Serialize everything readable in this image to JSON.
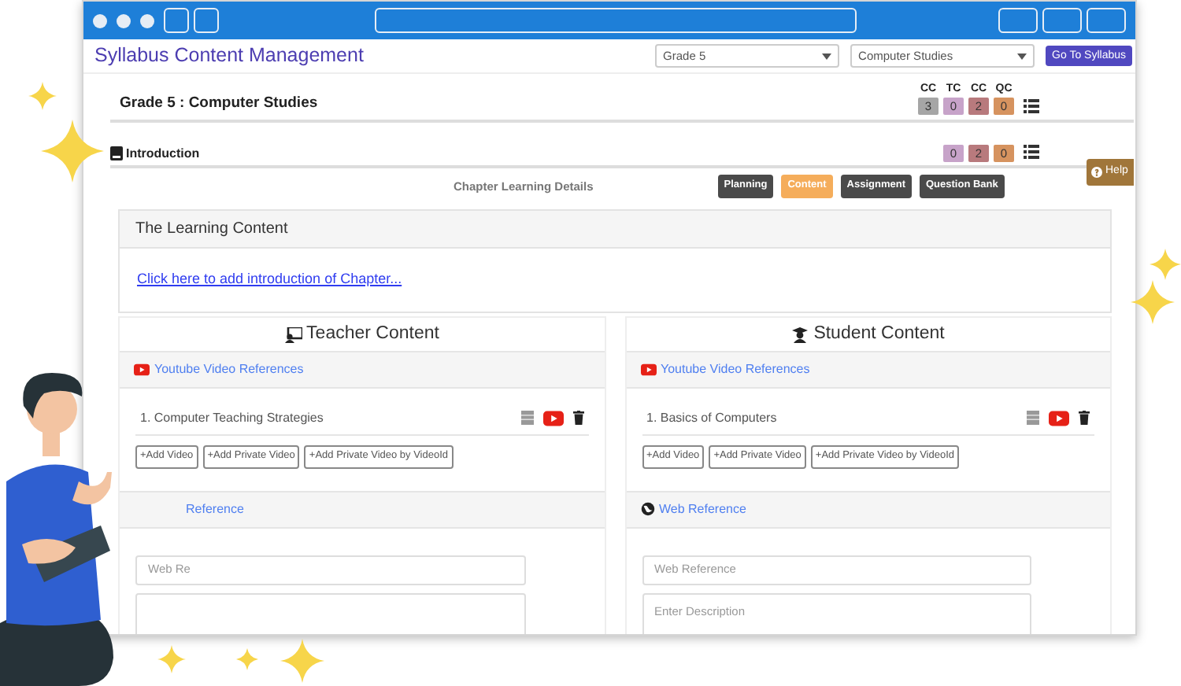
{
  "header": {
    "title": "Syllabus Content Management",
    "selects": [
      {
        "value": "Grade 5"
      },
      {
        "value": "Computer Studies"
      }
    ],
    "button": "Go To Syllabus"
  },
  "course": {
    "title": "Grade 5 : Computer Studies",
    "counts": [
      {
        "label": "CC",
        "value": "3",
        "color": "#a6a6a6"
      },
      {
        "label": "TC",
        "value": "0",
        "color": "#c7a3c9"
      },
      {
        "label": "CC",
        "value": "2",
        "color": "#b87a7d"
      },
      {
        "label": "QC",
        "value": "0",
        "color": "#d6935f"
      }
    ]
  },
  "chapter": {
    "title": "Introduction",
    "counts": [
      {
        "value": "0",
        "color": "#c7a3c9"
      },
      {
        "value": "2",
        "color": "#b87a7d"
      },
      {
        "value": "0",
        "color": "#d6935f"
      }
    ]
  },
  "help": "Help",
  "details": {
    "label": "Chapter Learning Details",
    "tabs": [
      {
        "label": "Planning",
        "selected": false
      },
      {
        "label": "Content",
        "selected": true
      },
      {
        "label": "Assignment",
        "selected": false
      },
      {
        "label": "Question Bank",
        "selected": false
      }
    ]
  },
  "learning": {
    "title": "The Learning Content",
    "link": "Click here to add introduction of Chapter..."
  },
  "columns": [
    {
      "title": "Teacher Content",
      "kind": "teacher",
      "videos": {
        "title": "Youtube Video References",
        "items": [
          "1. Computer Teaching Strategies"
        ],
        "buttons": [
          "+Add Video",
          "+Add Private Video",
          "+Add Private Video by VideoId"
        ]
      },
      "web": {
        "title": "Reference",
        "icon_visible": false,
        "fields": [
          {
            "kind": "input",
            "placeholder": "Web Re"
          },
          {
            "kind": "textarea"
          }
        ]
      }
    },
    {
      "title": "Student Content",
      "kind": "student",
      "videos": {
        "title": "Youtube Video References",
        "items": [
          "1. Basics of Computers"
        ],
        "buttons": [
          "+Add Video",
          "+Add Private Video",
          "+Add Private Video by VideoId"
        ]
      },
      "web": {
        "title": "Web Reference",
        "icon_visible": true,
        "fields": [
          {
            "kind": "input",
            "placeholder": "Web Reference"
          },
          {
            "kind": "textarea",
            "placeholder": "Enter Description"
          }
        ]
      }
    }
  ]
}
